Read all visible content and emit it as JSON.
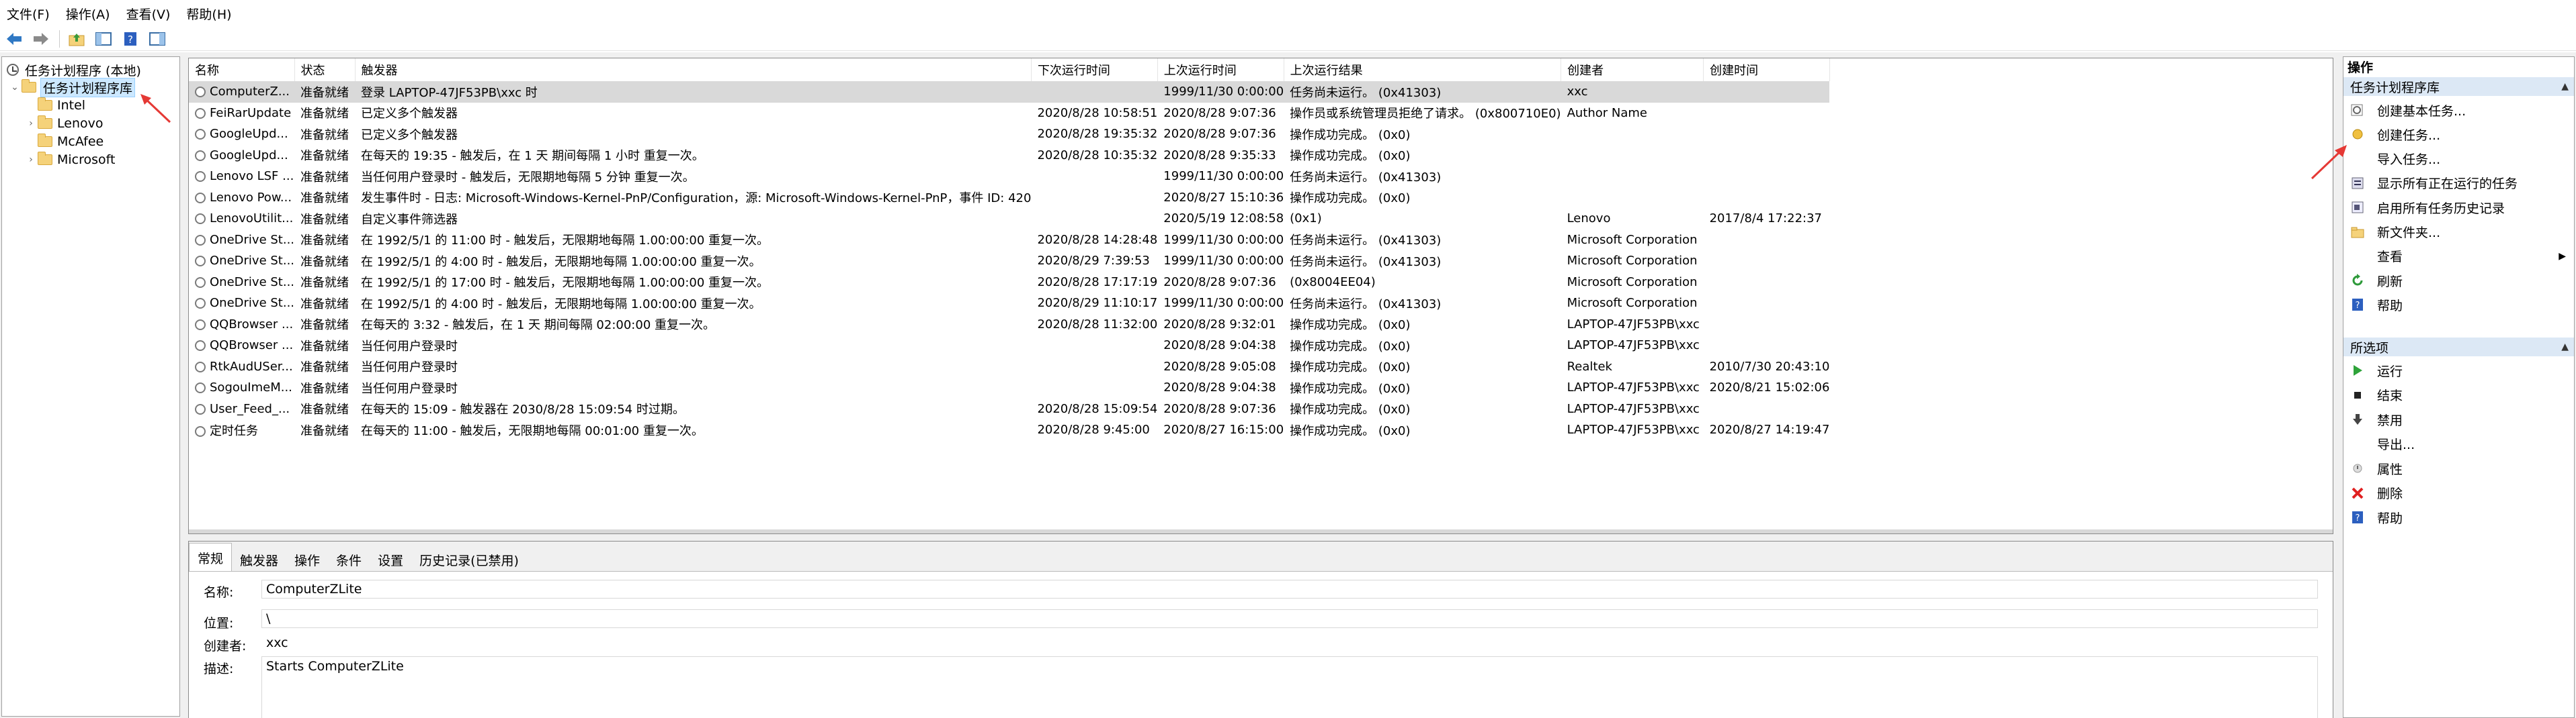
{
  "menu": [
    "文件(F)",
    "操作(A)",
    "查看(V)",
    "帮助(H)"
  ],
  "toolbar": {
    "icons": [
      "back-arrow-icon",
      "forward-arrow-icon",
      "folder-up-icon",
      "show-hide-console-tree-icon",
      "help-icon",
      "show-hide-action-pane-icon"
    ]
  },
  "tree": {
    "root": "任务计划程序 (本地)",
    "library": "任务计划程序库",
    "folders": [
      "Intel",
      "Lenovo",
      "McAfee",
      "Microsoft"
    ]
  },
  "grid": {
    "columns": [
      "名称",
      "状态",
      "触发器",
      "下次运行时间",
      "上次运行时间",
      "上次运行结果",
      "创建者",
      "创建时间"
    ],
    "rows": [
      [
        "ComputerZ...",
        "准备就绪",
        "登录 LAPTOP-47JF53PB\\xxc 时",
        "",
        "1999/11/30 0:00:00",
        "任务尚未运行。 (0x41303)",
        "xxc",
        ""
      ],
      [
        "FeiRarUpdate",
        "准备就绪",
        "已定义多个触发器",
        "2020/8/28 10:58:51",
        "2020/8/28 9:07:36",
        "操作员或系统管理员拒绝了请求。 (0x800710E0)",
        "Author Name",
        ""
      ],
      [
        "GoogleUpd...",
        "准备就绪",
        "已定义多个触发器",
        "2020/8/28 19:35:32",
        "2020/8/28 9:07:36",
        "操作成功完成。 (0x0)",
        "",
        ""
      ],
      [
        "GoogleUpd...",
        "准备就绪",
        "在每天的 19:35 - 触发后，在 1 天 期间每隔 1 小时 重复一次。",
        "2020/8/28 10:35:32",
        "2020/8/28 9:35:33",
        "操作成功完成。 (0x0)",
        "",
        ""
      ],
      [
        "Lenovo LSF ...",
        "准备就绪",
        "当任何用户登录时 - 触发后，无限期地每隔 5 分钟 重复一次。",
        "",
        "1999/11/30 0:00:00",
        "任务尚未运行。 (0x41303)",
        "",
        ""
      ],
      [
        "Lenovo Pow...",
        "准备就绪",
        "发生事件时 - 日志: Microsoft-Windows-Kernel-PnP/Configuration，源: Microsoft-Windows-Kernel-PnP，事件 ID: 420",
        "",
        "2020/8/27 15:10:36",
        "操作成功完成。 (0x0)",
        "",
        ""
      ],
      [
        "LenovoUtilit...",
        "准备就绪",
        "自定义事件筛选器",
        "",
        "2020/5/19 12:08:58",
        "(0x1)",
        "Lenovo",
        "2017/8/4 17:22:37"
      ],
      [
        "OneDrive St...",
        "准备就绪",
        "在 1992/5/1 的 11:00 时 - 触发后，无限期地每隔 1.00:00:00 重复一次。",
        "2020/8/28 14:28:48",
        "1999/11/30 0:00:00",
        "任务尚未运行。 (0x41303)",
        "Microsoft Corporation",
        ""
      ],
      [
        "OneDrive St...",
        "准备就绪",
        "在 1992/5/1 的 4:00 时 - 触发后，无限期地每隔 1.00:00:00 重复一次。",
        "2020/8/29 7:39:53",
        "1999/11/30 0:00:00",
        "任务尚未运行。 (0x41303)",
        "Microsoft Corporation",
        ""
      ],
      [
        "OneDrive St...",
        "准备就绪",
        "在 1992/5/1 的 17:00 时 - 触发后，无限期地每隔 1.00:00:00 重复一次。",
        "2020/8/28 17:17:19",
        "2020/8/28 9:07:36",
        "(0x8004EE04)",
        "Microsoft Corporation",
        ""
      ],
      [
        "OneDrive St...",
        "准备就绪",
        "在 1992/5/1 的 4:00 时 - 触发后，无限期地每隔 1.00:00:00 重复一次。",
        "2020/8/29 11:10:17",
        "1999/11/30 0:00:00",
        "任务尚未运行。 (0x41303)",
        "Microsoft Corporation",
        ""
      ],
      [
        "QQBrowser ...",
        "准备就绪",
        "在每天的 3:32 - 触发后，在 1 天 期间每隔 02:00:00 重复一次。",
        "2020/8/28 11:32:00",
        "2020/8/28 9:32:01",
        "操作成功完成。 (0x0)",
        "LAPTOP-47JF53PB\\xxc",
        ""
      ],
      [
        "QQBrowser ...",
        "准备就绪",
        "当任何用户登录时",
        "",
        "2020/8/28 9:04:38",
        "操作成功完成。 (0x0)",
        "LAPTOP-47JF53PB\\xxc",
        ""
      ],
      [
        "RtkAudUSer...",
        "准备就绪",
        "当任何用户登录时",
        "",
        "2020/8/28 9:05:08",
        "操作成功完成。 (0x0)",
        "Realtek",
        "2010/7/30 20:43:10"
      ],
      [
        "SogouImeM...",
        "准备就绪",
        "当任何用户登录时",
        "",
        "2020/8/28 9:04:38",
        "操作成功完成。 (0x0)",
        "LAPTOP-47JF53PB\\xxc",
        "2020/8/21 15:02:06"
      ],
      [
        "User_Feed_...",
        "准备就绪",
        "在每天的 15:09 - 触发器在 2030/8/28 15:09:54 时过期。",
        "2020/8/28 15:09:54",
        "2020/8/28 9:07:36",
        "操作成功完成。 (0x0)",
        "LAPTOP-47JF53PB\\xxc",
        ""
      ],
      [
        "定时任务",
        "准备就绪",
        "在每天的 11:00 - 触发后，无限期地每隔 00:01:00 重复一次。",
        "2020/8/28 9:45:00",
        "2020/8/27 16:15:00",
        "操作成功完成。 (0x0)",
        "LAPTOP-47JF53PB\\xxc",
        "2020/8/27 14:19:47"
      ]
    ]
  },
  "detail": {
    "tabs": [
      "常规",
      "触发器",
      "操作",
      "条件",
      "设置",
      "历史记录(已禁用)"
    ],
    "name_label": "名称:",
    "name_value": "ComputerZLite",
    "location_label": "位置:",
    "location_value": "\\",
    "author_label": "创建者:",
    "author_value": "xxc",
    "desc_label": "描述:",
    "desc_value": "Starts ComputerZLite"
  },
  "actions": {
    "title": "操作",
    "section1": "任务计划程序库",
    "items1": [
      "创建基本任务...",
      "创建任务...",
      "导入任务...",
      "显示所有正在运行的任务",
      "启用所有任务历史记录",
      "新文件夹...",
      "查看",
      "刷新",
      "帮助"
    ],
    "section2": "所选项",
    "items2": [
      "运行",
      "结束",
      "禁用",
      "导出...",
      "属性",
      "删除",
      "帮助"
    ]
  },
  "colors": {
    "annotation_arrow": "#e53935",
    "section_header_bg": "#dce8f5",
    "selected_row_bg": "#d9d9d9",
    "tree_selection_bg": "#cce8ff"
  }
}
